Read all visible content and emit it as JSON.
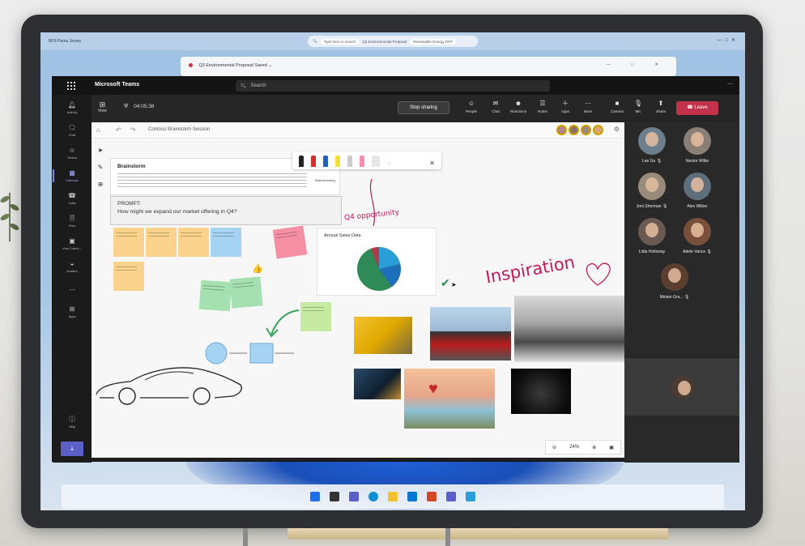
{
  "os": {
    "app_label": "BFS Puma Jersey",
    "search_placeholder": "Type here to search",
    "tab_1": "Q3 Environmental Proposal",
    "tab_2": "Renewable Energy RFP",
    "bg_window_title": "Q3 Environmental Proposal  Saved ⌄"
  },
  "teams": {
    "app_title": "Microsoft Teams",
    "search_placeholder": "Search",
    "rail": [
      "Activity",
      "Chat",
      "Teams",
      "Calendar",
      "Calls",
      "Files",
      "Viva Conne...",
      "Avatars",
      "Apps",
      "Help"
    ],
    "toolbar": {
      "view": "View",
      "timer": "04:05:38",
      "stop_sharing": "Stop sharing",
      "people": "People",
      "chat": "Chat",
      "reactions": "Reactions",
      "notes": "Notes",
      "apps": "Apps",
      "more": "More",
      "camera": "Camera",
      "mic": "Mic",
      "share": "Share",
      "leave": "Leave"
    }
  },
  "whiteboard": {
    "session_name": "Contoso Brainstorm Session",
    "brainstorm_title": "Brainstorm",
    "brainstorm_tag": "Brainstorming",
    "prompt_label": "PROMPT:",
    "prompt_question": "How might we expand our market offering in Q4?",
    "q4_note": "Q4 opportunity",
    "inspiration": "Inspiration",
    "chart_title": "Annual Sales Data",
    "zoom_level": "24%"
  },
  "participants": [
    {
      "name": "Lee Gu"
    },
    {
      "name": "Nestor Wilke"
    },
    {
      "name": "Joni Sherman"
    },
    {
      "name": "Alex Wilber"
    },
    {
      "name": "Lidia Holloway"
    },
    {
      "name": "Adele Vance"
    },
    {
      "name": "Miriam Gra..."
    }
  ],
  "colors": {
    "teams_purple": "#5b5fc7",
    "leave_red": "#c4314b",
    "ink_magenta": "#c2185b"
  }
}
